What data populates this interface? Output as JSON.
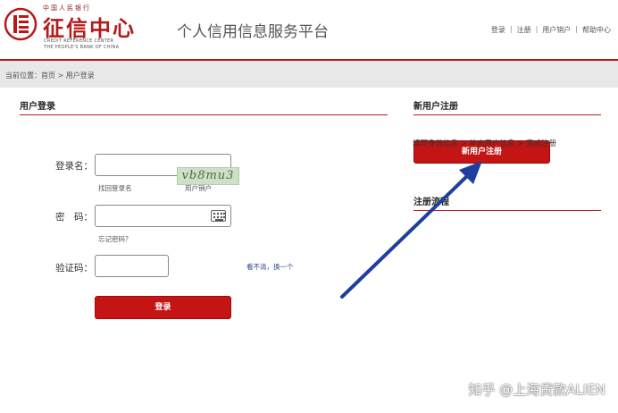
{
  "header": {
    "logo_top": "中国人民银行",
    "logo_main": "征信中心",
    "logo_en1": "CREDIT REFERENCE CENTER",
    "logo_en2": "THE PEOPLE'S BANK OF CHINA",
    "platform_title": "个人信用信息服务平台",
    "links": [
      "登录",
      "注册",
      "用户销户",
      "帮助中心"
    ]
  },
  "breadcrumb": "当前位置：首页 > 用户登录",
  "login": {
    "title": "用户登录",
    "username_label": "登录名：",
    "username_value": "",
    "find_login_name": "找回登录名",
    "user_cancel": "用户销户",
    "password_label": "密　码：",
    "password_value": "",
    "forgot_password": "忘记密码？",
    "captcha_label": "验证码：",
    "captcha_value": "",
    "captcha_image_text": "vb8mu3",
    "refresh_text": "看不清，换一个",
    "submit_label": "登录"
  },
  "register": {
    "title": "新用户注册",
    "button_label": "新用户注册",
    "process_title": "注册流程",
    "process_text": "填写身份信息 > 补充用户信息 > 完成注册"
  },
  "watermark": "知乎 @上海贷款ALIEN",
  "colors": {
    "brand_red": "#b51a1a",
    "button_red": "#c41414",
    "arrow_blue": "#1f3f9e"
  },
  "icons": {
    "keyboard": "keyboard-icon",
    "seal": "seal-logo-icon",
    "arrow": "arrow-annotation"
  }
}
